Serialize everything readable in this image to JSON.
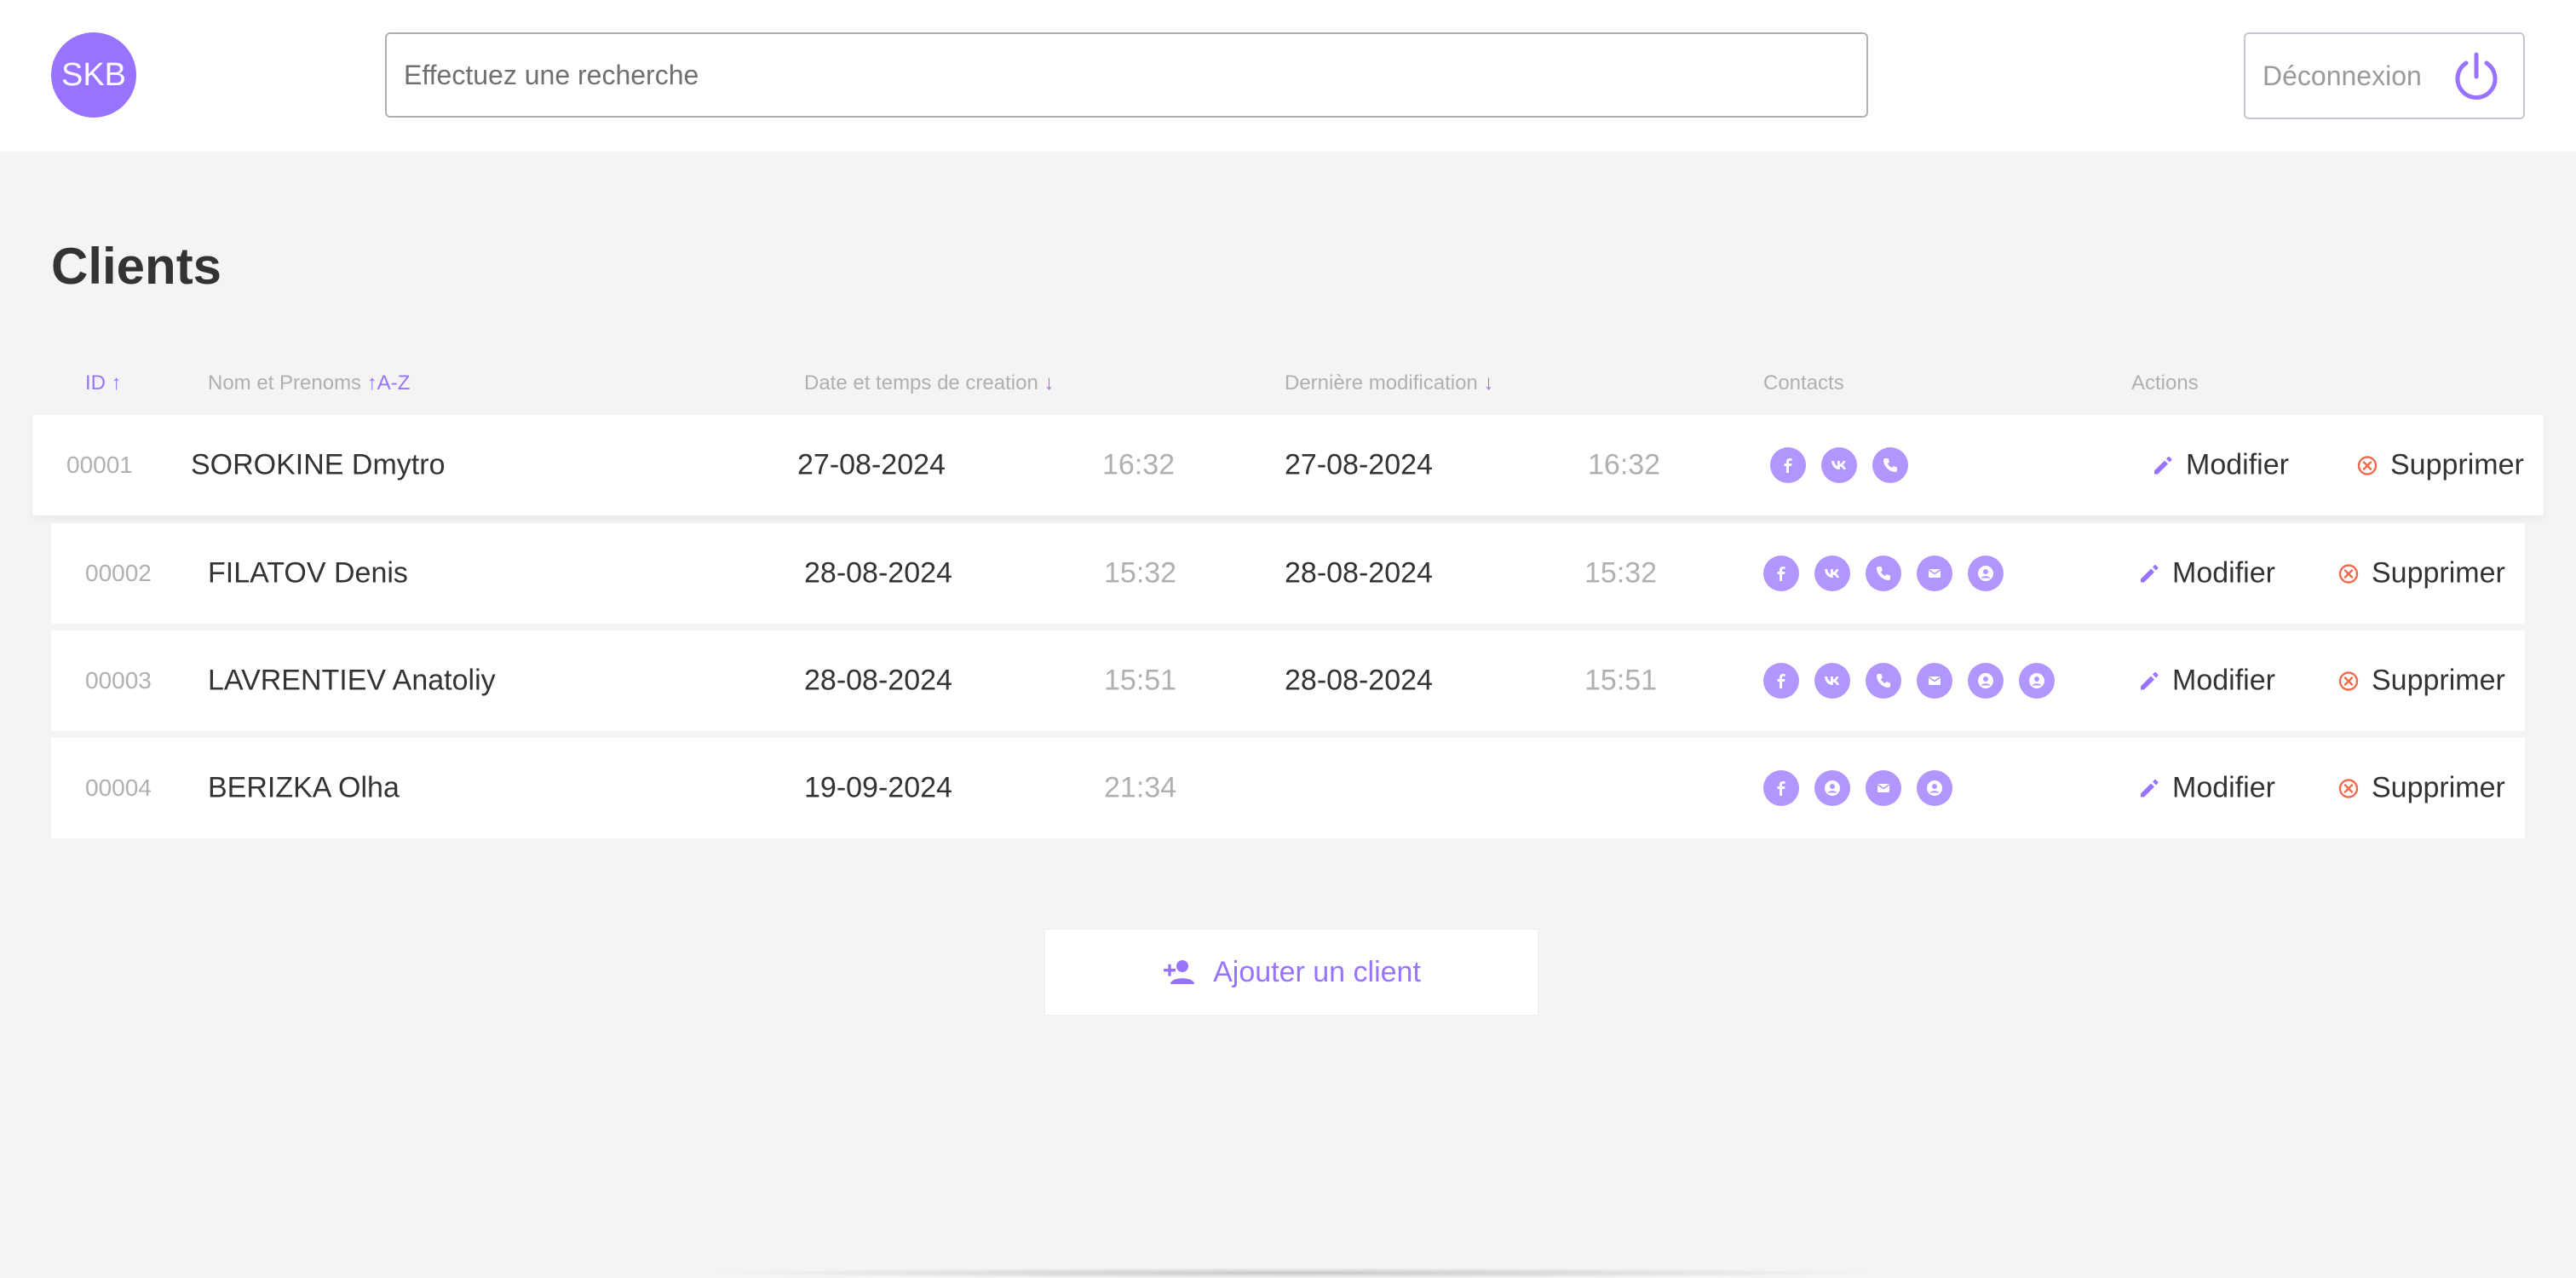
{
  "header": {
    "logo_text": "SKB",
    "search_placeholder": "Effectuez une recherche",
    "logout_label": "Déconnexion",
    "logout_icon": "power-icon"
  },
  "page": {
    "title": "Clients"
  },
  "columns": {
    "id": "ID",
    "id_sort": "↑",
    "name": "Nom et Prenoms",
    "name_sort": "↑A-Z",
    "created": "Date et temps de creation",
    "created_sort": "↓",
    "modified": "Dernière modification",
    "modified_sort": "↓",
    "contacts": "Contacts",
    "actions": "Actions"
  },
  "rows": [
    {
      "id": "00001",
      "name": "SOROKINE Dmytro",
      "created_date": "27-08-2024",
      "created_time": "16:32",
      "modified_date": "27-08-2024",
      "modified_time": "16:32",
      "contacts": [
        "facebook-icon",
        "vk-icon",
        "phone-icon"
      ]
    },
    {
      "id": "00002",
      "name": "FILATOV Denis",
      "created_date": "28-08-2024",
      "created_time": "15:32",
      "modified_date": "28-08-2024",
      "modified_time": "15:32",
      "contacts": [
        "facebook-icon",
        "vk-icon",
        "phone-icon",
        "mail-icon",
        "user-icon"
      ]
    },
    {
      "id": "00003",
      "name": "LAVRENTIEV Anatoliy",
      "created_date": "28-08-2024",
      "created_time": "15:51",
      "modified_date": "28-08-2024",
      "modified_time": "15:51",
      "contacts": [
        "facebook-icon",
        "vk-icon",
        "phone-icon",
        "mail-icon",
        "user-icon",
        "user-icon"
      ]
    },
    {
      "id": "00004",
      "name": "BERIZKA Olha",
      "created_date": "19-09-2024",
      "created_time": "21:34",
      "modified_date": "",
      "modified_time": "",
      "contacts": [
        "facebook-icon",
        "user-icon",
        "mail-icon",
        "user-icon"
      ]
    }
  ],
  "actions": {
    "edit_label": "Modifier",
    "delete_label": "Supprimer"
  },
  "add_button": {
    "label": "Ajouter un client"
  },
  "colors": {
    "accent": "#9873ff",
    "danger": "#f06a4d",
    "background": "#f4f4f4"
  }
}
